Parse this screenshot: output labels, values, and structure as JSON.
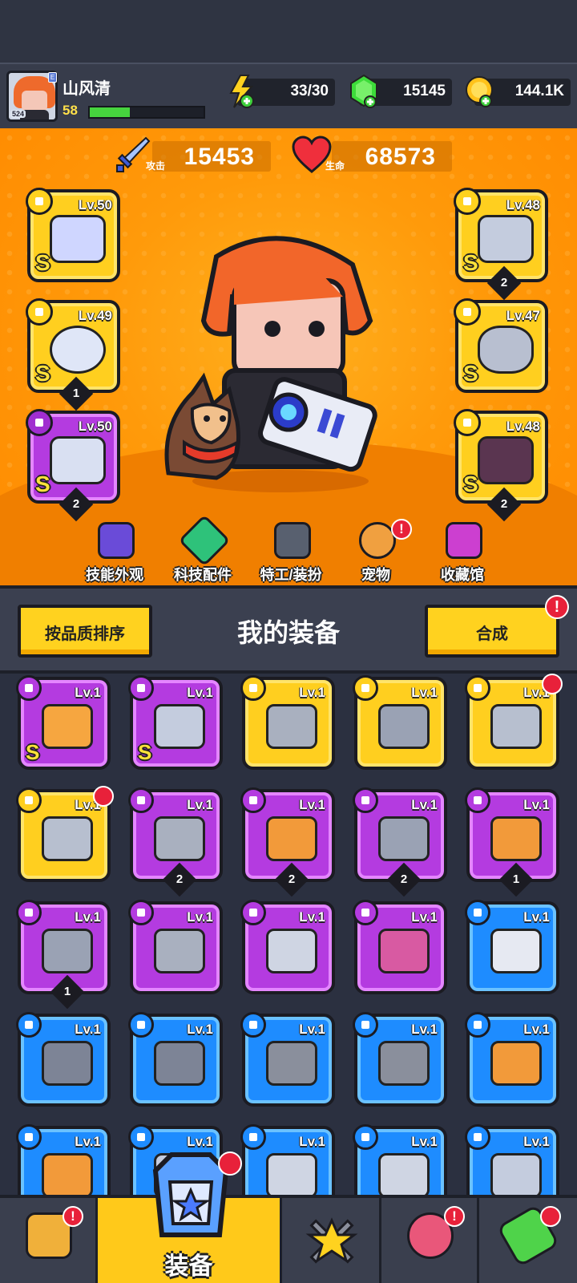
{
  "player": {
    "name": "山风清",
    "level": "58",
    "avatar_level": "524",
    "xp_fraction": 0.35
  },
  "resources": {
    "energy": "33/30",
    "gems": "15145",
    "coins": "144.1K"
  },
  "stats": {
    "attack_value": "15453",
    "attack_label": "攻击",
    "hp_value": "68573",
    "hp_label": "生命"
  },
  "hero_slots": {
    "left": [
      {
        "level": "Lv.50",
        "grade": "S",
        "color": "gold",
        "count": ""
      },
      {
        "level": "Lv.49",
        "grade": "S",
        "color": "gold",
        "count": "1"
      },
      {
        "level": "Lv.50",
        "grade": "S",
        "color": "purple",
        "count": "2"
      }
    ],
    "right": [
      {
        "level": "Lv.48",
        "grade": "S",
        "color": "gold",
        "count": "2"
      },
      {
        "level": "Lv.47",
        "grade": "S",
        "color": "gold",
        "count": ""
      },
      {
        "level": "Lv.48",
        "grade": "S",
        "color": "gold",
        "count": "2"
      }
    ]
  },
  "hero_menu": [
    "技能外观",
    "科技配件",
    "特工/装扮",
    "宠物",
    "收藏馆"
  ],
  "equipment": {
    "sort_button": "按品质排序",
    "title": "我的装备",
    "merge_button": "合成",
    "alert_mark": "!"
  },
  "items": [
    {
      "level": "Lv.1",
      "color": "purple",
      "grade": "S",
      "count": "",
      "alert": false,
      "icon": "sword"
    },
    {
      "level": "Lv.1",
      "color": "purple",
      "grade": "S",
      "count": "",
      "alert": false,
      "icon": "armor"
    },
    {
      "level": "Lv.1",
      "color": "gold",
      "grade": "",
      "count": "",
      "alert": false,
      "icon": "kunai"
    },
    {
      "level": "Lv.1",
      "color": "gold",
      "grade": "",
      "count": "",
      "alert": false,
      "icon": "belt"
    },
    {
      "level": "Lv.1",
      "color": "gold",
      "grade": "",
      "count": "",
      "alert": true,
      "icon": "gauntlet"
    },
    {
      "level": "Lv.1",
      "color": "gold",
      "grade": "",
      "count": "",
      "alert": true,
      "icon": "gauntlet"
    },
    {
      "level": "Lv.1",
      "color": "purple",
      "grade": "",
      "count": "2",
      "alert": false,
      "icon": "kunai"
    },
    {
      "level": "Lv.1",
      "color": "purple",
      "grade": "",
      "count": "2",
      "alert": false,
      "icon": "club"
    },
    {
      "level": "Lv.1",
      "color": "purple",
      "grade": "",
      "count": "2",
      "alert": false,
      "icon": "belt"
    },
    {
      "level": "Lv.1",
      "color": "purple",
      "grade": "",
      "count": "1",
      "alert": false,
      "icon": "club"
    },
    {
      "level": "Lv.1",
      "color": "purple",
      "grade": "",
      "count": "1",
      "alert": false,
      "icon": "belt"
    },
    {
      "level": "Lv.1",
      "color": "purple",
      "grade": "",
      "count": "",
      "alert": false,
      "icon": "kunai"
    },
    {
      "level": "Lv.1",
      "color": "purple",
      "grade": "",
      "count": "",
      "alert": false,
      "icon": "vest"
    },
    {
      "level": "Lv.1",
      "color": "purple",
      "grade": "",
      "count": "",
      "alert": false,
      "icon": "boot"
    },
    {
      "level": "Lv.1",
      "color": "blue",
      "grade": "",
      "count": "",
      "alert": false,
      "icon": "machete"
    },
    {
      "level": "Lv.1",
      "color": "blue",
      "grade": "",
      "count": "",
      "alert": false,
      "icon": "revolver"
    },
    {
      "level": "Lv.1",
      "color": "blue",
      "grade": "",
      "count": "",
      "alert": false,
      "icon": "revolver"
    },
    {
      "level": "Lv.1",
      "color": "blue",
      "grade": "",
      "count": "",
      "alert": false,
      "icon": "shotgun"
    },
    {
      "level": "Lv.1",
      "color": "blue",
      "grade": "",
      "count": "",
      "alert": false,
      "icon": "shotgun"
    },
    {
      "level": "Lv.1",
      "color": "blue",
      "grade": "",
      "count": "",
      "alert": false,
      "icon": "bat"
    },
    {
      "level": "Lv.1",
      "color": "blue",
      "grade": "",
      "count": "",
      "alert": false,
      "icon": "bat"
    },
    {
      "level": "Lv.1",
      "color": "blue",
      "grade": "",
      "count": "",
      "alert": false,
      "icon": "armor"
    },
    {
      "level": "Lv.1",
      "color": "blue",
      "grade": "",
      "count": "",
      "alert": false,
      "icon": "vest"
    },
    {
      "level": "Lv.1",
      "color": "blue",
      "grade": "",
      "count": "",
      "alert": false,
      "icon": "vest"
    },
    {
      "level": "Lv.1",
      "color": "blue",
      "grade": "",
      "count": "",
      "alert": false,
      "icon": "armor"
    }
  ],
  "nav": {
    "active_label": "装备",
    "alert_mark": "!",
    "tabs": [
      "shop",
      "equipment",
      "battle",
      "pets",
      "lab"
    ]
  }
}
